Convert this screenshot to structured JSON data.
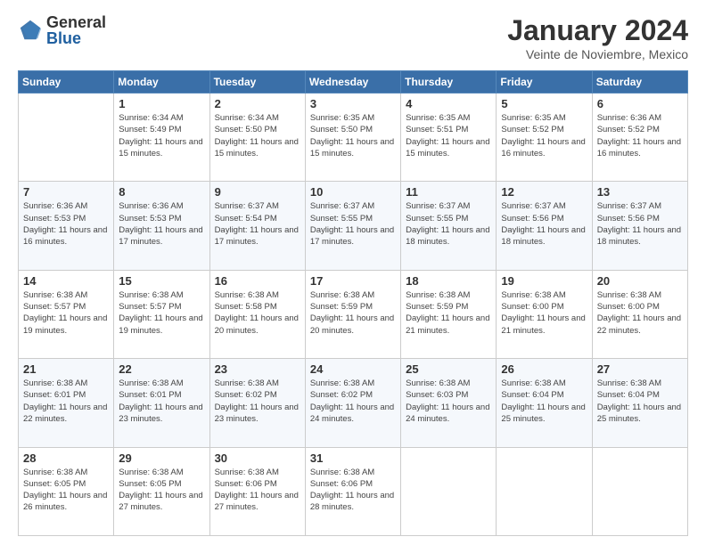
{
  "logo": {
    "general": "General",
    "blue": "Blue"
  },
  "title": "January 2024",
  "subtitle": "Veinte de Noviembre, Mexico",
  "days_of_week": [
    "Sunday",
    "Monday",
    "Tuesday",
    "Wednesday",
    "Thursday",
    "Friday",
    "Saturday"
  ],
  "weeks": [
    [
      {
        "day": "",
        "sunrise": "",
        "sunset": "",
        "daylight": ""
      },
      {
        "day": "1",
        "sunrise": "Sunrise: 6:34 AM",
        "sunset": "Sunset: 5:49 PM",
        "daylight": "Daylight: 11 hours and 15 minutes."
      },
      {
        "day": "2",
        "sunrise": "Sunrise: 6:34 AM",
        "sunset": "Sunset: 5:50 PM",
        "daylight": "Daylight: 11 hours and 15 minutes."
      },
      {
        "day": "3",
        "sunrise": "Sunrise: 6:35 AM",
        "sunset": "Sunset: 5:50 PM",
        "daylight": "Daylight: 11 hours and 15 minutes."
      },
      {
        "day": "4",
        "sunrise": "Sunrise: 6:35 AM",
        "sunset": "Sunset: 5:51 PM",
        "daylight": "Daylight: 11 hours and 15 minutes."
      },
      {
        "day": "5",
        "sunrise": "Sunrise: 6:35 AM",
        "sunset": "Sunset: 5:52 PM",
        "daylight": "Daylight: 11 hours and 16 minutes."
      },
      {
        "day": "6",
        "sunrise": "Sunrise: 6:36 AM",
        "sunset": "Sunset: 5:52 PM",
        "daylight": "Daylight: 11 hours and 16 minutes."
      }
    ],
    [
      {
        "day": "7",
        "sunrise": "Sunrise: 6:36 AM",
        "sunset": "Sunset: 5:53 PM",
        "daylight": "Daylight: 11 hours and 16 minutes."
      },
      {
        "day": "8",
        "sunrise": "Sunrise: 6:36 AM",
        "sunset": "Sunset: 5:53 PM",
        "daylight": "Daylight: 11 hours and 17 minutes."
      },
      {
        "day": "9",
        "sunrise": "Sunrise: 6:37 AM",
        "sunset": "Sunset: 5:54 PM",
        "daylight": "Daylight: 11 hours and 17 minutes."
      },
      {
        "day": "10",
        "sunrise": "Sunrise: 6:37 AM",
        "sunset": "Sunset: 5:55 PM",
        "daylight": "Daylight: 11 hours and 17 minutes."
      },
      {
        "day": "11",
        "sunrise": "Sunrise: 6:37 AM",
        "sunset": "Sunset: 5:55 PM",
        "daylight": "Daylight: 11 hours and 18 minutes."
      },
      {
        "day": "12",
        "sunrise": "Sunrise: 6:37 AM",
        "sunset": "Sunset: 5:56 PM",
        "daylight": "Daylight: 11 hours and 18 minutes."
      },
      {
        "day": "13",
        "sunrise": "Sunrise: 6:37 AM",
        "sunset": "Sunset: 5:56 PM",
        "daylight": "Daylight: 11 hours and 18 minutes."
      }
    ],
    [
      {
        "day": "14",
        "sunrise": "Sunrise: 6:38 AM",
        "sunset": "Sunset: 5:57 PM",
        "daylight": "Daylight: 11 hours and 19 minutes."
      },
      {
        "day": "15",
        "sunrise": "Sunrise: 6:38 AM",
        "sunset": "Sunset: 5:57 PM",
        "daylight": "Daylight: 11 hours and 19 minutes."
      },
      {
        "day": "16",
        "sunrise": "Sunrise: 6:38 AM",
        "sunset": "Sunset: 5:58 PM",
        "daylight": "Daylight: 11 hours and 20 minutes."
      },
      {
        "day": "17",
        "sunrise": "Sunrise: 6:38 AM",
        "sunset": "Sunset: 5:59 PM",
        "daylight": "Daylight: 11 hours and 20 minutes."
      },
      {
        "day": "18",
        "sunrise": "Sunrise: 6:38 AM",
        "sunset": "Sunset: 5:59 PM",
        "daylight": "Daylight: 11 hours and 21 minutes."
      },
      {
        "day": "19",
        "sunrise": "Sunrise: 6:38 AM",
        "sunset": "Sunset: 6:00 PM",
        "daylight": "Daylight: 11 hours and 21 minutes."
      },
      {
        "day": "20",
        "sunrise": "Sunrise: 6:38 AM",
        "sunset": "Sunset: 6:00 PM",
        "daylight": "Daylight: 11 hours and 22 minutes."
      }
    ],
    [
      {
        "day": "21",
        "sunrise": "Sunrise: 6:38 AM",
        "sunset": "Sunset: 6:01 PM",
        "daylight": "Daylight: 11 hours and 22 minutes."
      },
      {
        "day": "22",
        "sunrise": "Sunrise: 6:38 AM",
        "sunset": "Sunset: 6:01 PM",
        "daylight": "Daylight: 11 hours and 23 minutes."
      },
      {
        "day": "23",
        "sunrise": "Sunrise: 6:38 AM",
        "sunset": "Sunset: 6:02 PM",
        "daylight": "Daylight: 11 hours and 23 minutes."
      },
      {
        "day": "24",
        "sunrise": "Sunrise: 6:38 AM",
        "sunset": "Sunset: 6:02 PM",
        "daylight": "Daylight: 11 hours and 24 minutes."
      },
      {
        "day": "25",
        "sunrise": "Sunrise: 6:38 AM",
        "sunset": "Sunset: 6:03 PM",
        "daylight": "Daylight: 11 hours and 24 minutes."
      },
      {
        "day": "26",
        "sunrise": "Sunrise: 6:38 AM",
        "sunset": "Sunset: 6:04 PM",
        "daylight": "Daylight: 11 hours and 25 minutes."
      },
      {
        "day": "27",
        "sunrise": "Sunrise: 6:38 AM",
        "sunset": "Sunset: 6:04 PM",
        "daylight": "Daylight: 11 hours and 25 minutes."
      }
    ],
    [
      {
        "day": "28",
        "sunrise": "Sunrise: 6:38 AM",
        "sunset": "Sunset: 6:05 PM",
        "daylight": "Daylight: 11 hours and 26 minutes."
      },
      {
        "day": "29",
        "sunrise": "Sunrise: 6:38 AM",
        "sunset": "Sunset: 6:05 PM",
        "daylight": "Daylight: 11 hours and 27 minutes."
      },
      {
        "day": "30",
        "sunrise": "Sunrise: 6:38 AM",
        "sunset": "Sunset: 6:06 PM",
        "daylight": "Daylight: 11 hours and 27 minutes."
      },
      {
        "day": "31",
        "sunrise": "Sunrise: 6:38 AM",
        "sunset": "Sunset: 6:06 PM",
        "daylight": "Daylight: 11 hours and 28 minutes."
      },
      {
        "day": "",
        "sunrise": "",
        "sunset": "",
        "daylight": ""
      },
      {
        "day": "",
        "sunrise": "",
        "sunset": "",
        "daylight": ""
      },
      {
        "day": "",
        "sunrise": "",
        "sunset": "",
        "daylight": ""
      }
    ]
  ]
}
